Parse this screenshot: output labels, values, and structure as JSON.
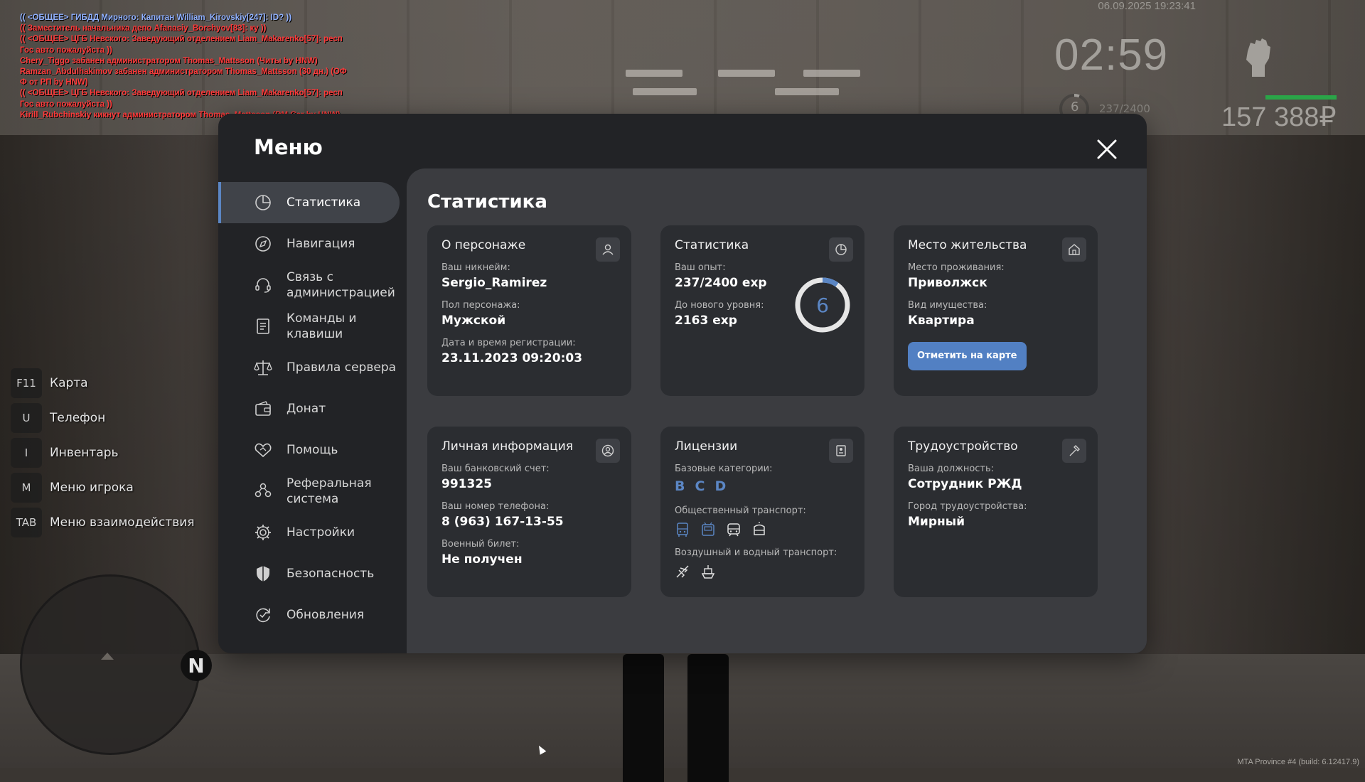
{
  "chat": [
    {
      "text": "(( <ОБЩЕЕ> ГИБДД Мирного: Капитан William_Kirovskiy[247]: ID? ))",
      "color": "#8fb0ff"
    },
    {
      "text": "(( Заместитель начальника депо Afanasiy_Borshyov[83]: ку ))",
      "color": "#ff3b3b"
    },
    {
      "text": "(( <ОБЩЕЕ> ЦГБ Невского: Заведующий отделением Liam_Makarenko[57]: респ",
      "color": "#ff3b3b"
    },
    {
      "text": "Гос авто пожалуйста ))",
      "color": "#ff3b3b"
    },
    {
      "text": "Chery_Tiggo забанен администратором Thomas_Mattsson (Читы by HNW)",
      "color": "#ff3b3b"
    },
    {
      "text": "Ramzan_Abdulhakimov забанен администратором Thomas_Mattsson (30 дн.) (ОФ",
      "color": "#ff3b3b"
    },
    {
      "text": "Ф от РП by HNW)",
      "color": "#ff3b3b"
    },
    {
      "text": "(( <ОБЩЕЕ> ЦГБ Невского: Заведующий отделением Liam_Makarenko[57]: респ",
      "color": "#ff3b3b"
    },
    {
      "text": "Гос авто пожалуйста ))",
      "color": "#ff3b3b"
    },
    {
      "text": "Kirill_Rubchinskiy кикнут администратором Thomas_Mattsson (DM Car by HNW)",
      "color": "#ff3b3b"
    }
  ],
  "hud": {
    "datetime": "06.09.2025 19:23:41",
    "time": "02:59",
    "level": "6",
    "exp": "237/2400",
    "money": "157 388₽",
    "accent": "#2aa548"
  },
  "keys": [
    {
      "key": "F11",
      "label": "Карта"
    },
    {
      "key": "U",
      "label": "Телефон"
    },
    {
      "key": "I",
      "label": "Инвентарь"
    },
    {
      "key": "M",
      "label": "Меню игрока"
    },
    {
      "key": "TAB",
      "label": "Меню взаимодействия"
    }
  ],
  "radar": {
    "north": "N"
  },
  "build": "MTA Province #4 (build: 6.12417.9)",
  "menu": {
    "title": "Меню",
    "accent": "#5b86c4",
    "sidebar": [
      {
        "label": "Статистика",
        "icon": "pie-chart-icon"
      },
      {
        "label": "Навигация",
        "icon": "compass-icon"
      },
      {
        "label": "Связь с администрацией",
        "icon": "headset-icon"
      },
      {
        "label": "Команды и клавиши",
        "icon": "document-icon"
      },
      {
        "label": "Правила сервера",
        "icon": "scales-icon"
      },
      {
        "label": "Донат",
        "icon": "wallet-icon"
      },
      {
        "label": "Помощь",
        "icon": "handshake-icon"
      },
      {
        "label": "Реферальная система",
        "icon": "people-icon"
      },
      {
        "label": "Настройки",
        "icon": "gear-icon"
      },
      {
        "label": "Безопасность",
        "icon": "shield-icon"
      },
      {
        "label": "Обновления",
        "icon": "refresh-icon"
      }
    ],
    "content_title": "Статистика",
    "cards": {
      "character": {
        "title": "О персонаже",
        "nickname_label": "Ваш никнейм:",
        "nickname": "Sergio_Ramirez",
        "gender_label": "Пол персонажа:",
        "gender": "Мужской",
        "reg_label": "Дата и время регистрации:",
        "reg": "23.11.2023 09:20:03"
      },
      "stats": {
        "title": "Статистика",
        "exp_label": "Ваш опыт:",
        "exp": "237/2400 exp",
        "next_label": "До нового уровня:",
        "next": "2163 exp",
        "level": "6",
        "progress": 0.099
      },
      "residence": {
        "title": "Место жительства",
        "place_label": "Место проживания:",
        "place": "Приволжск",
        "type_label": "Вид имущества:",
        "type": "Квартира",
        "button": "Отметить на карте"
      },
      "personal": {
        "title": "Личная информация",
        "bank_label": "Ваш банковский счет:",
        "bank": "991325",
        "phone_label": "Ваш номер телефона:",
        "phone": "8 (963) 167-13-55",
        "military_label": "Военный билет:",
        "military": "Не получен"
      },
      "licenses": {
        "title": "Лицензии",
        "base_label": "Базовые категории:",
        "base": [
          "B",
          "C",
          "D"
        ],
        "public_label": "Общественный транспорт:",
        "public_icons": [
          "bus-icon",
          "trolleybus-icon",
          "train-icon",
          "tram-icon"
        ],
        "air_label": "Воздушный и водный транспорт:",
        "air_icons": [
          "airplane-icon",
          "ship-icon"
        ]
      },
      "job": {
        "title": "Трудоустройство",
        "position_label": "Ваша должность:",
        "position": "Сотрудник РЖД",
        "city_label": "Город трудоустройства:",
        "city": "Мирный"
      }
    }
  }
}
